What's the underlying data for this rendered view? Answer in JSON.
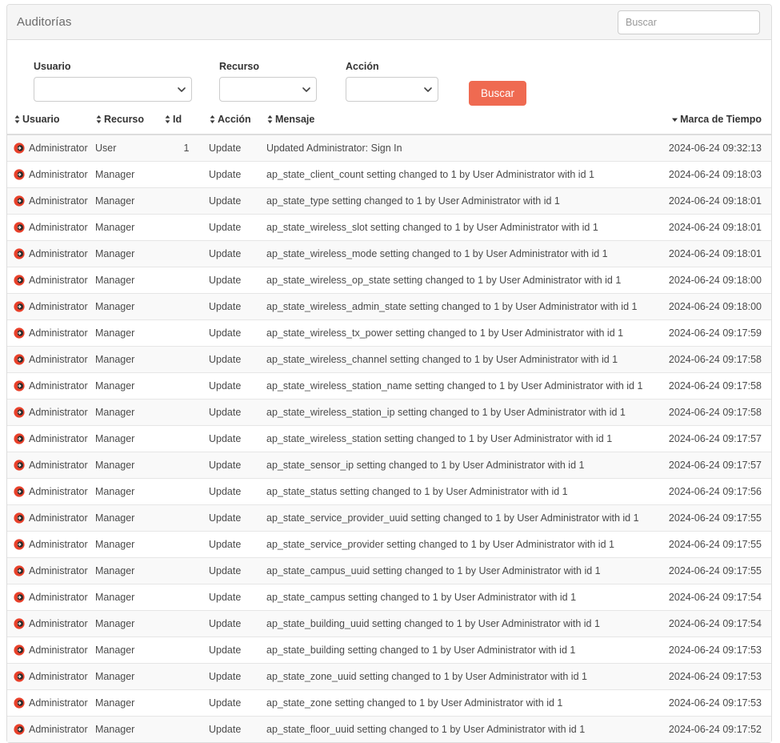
{
  "header": {
    "title": "Auditorías",
    "search_placeholder": "Buscar",
    "search_value": ""
  },
  "filters": {
    "groups": [
      {
        "label": "Usuario",
        "value": "",
        "options": [
          ""
        ]
      },
      {
        "label": "Recurso",
        "value": "",
        "options": [
          ""
        ]
      },
      {
        "label": "Acción",
        "value": "",
        "options": [
          ""
        ]
      }
    ],
    "submit_label": "Buscar"
  },
  "table": {
    "columns": [
      {
        "label": "Usuario",
        "sort": "both"
      },
      {
        "label": "Recurso",
        "sort": "both"
      },
      {
        "label": "Id",
        "sort": "both"
      },
      {
        "label": "Acción",
        "sort": "both"
      },
      {
        "label": "Mensaje",
        "sort": "both"
      },
      {
        "label": "Marca de Tiempo",
        "sort": "desc"
      }
    ],
    "row_icon": "user-circle-arrow-icon",
    "rows": [
      {
        "user": "Administrator",
        "resource": "User",
        "id": "1",
        "action": "Update",
        "message": "Updated Administrator: Sign In",
        "timestamp": "2024-06-24 09:32:13"
      },
      {
        "user": "Administrator",
        "resource": "Manager",
        "id": "",
        "action": "Update",
        "message": "ap_state_client_count setting changed to 1 by User Administrator with id 1",
        "timestamp": "2024-06-24 09:18:03"
      },
      {
        "user": "Administrator",
        "resource": "Manager",
        "id": "",
        "action": "Update",
        "message": "ap_state_type setting changed to 1 by User Administrator with id 1",
        "timestamp": "2024-06-24 09:18:01"
      },
      {
        "user": "Administrator",
        "resource": "Manager",
        "id": "",
        "action": "Update",
        "message": "ap_state_wireless_slot setting changed to 1 by User Administrator with id 1",
        "timestamp": "2024-06-24 09:18:01"
      },
      {
        "user": "Administrator",
        "resource": "Manager",
        "id": "",
        "action": "Update",
        "message": "ap_state_wireless_mode setting changed to 1 by User Administrator with id 1",
        "timestamp": "2024-06-24 09:18:01"
      },
      {
        "user": "Administrator",
        "resource": "Manager",
        "id": "",
        "action": "Update",
        "message": "ap_state_wireless_op_state setting changed to 1 by User Administrator with id 1",
        "timestamp": "2024-06-24 09:18:00"
      },
      {
        "user": "Administrator",
        "resource": "Manager",
        "id": "",
        "action": "Update",
        "message": "ap_state_wireless_admin_state setting changed to 1 by User Administrator with id 1",
        "timestamp": "2024-06-24 09:18:00"
      },
      {
        "user": "Administrator",
        "resource": "Manager",
        "id": "",
        "action": "Update",
        "message": "ap_state_wireless_tx_power setting changed to 1 by User Administrator with id 1",
        "timestamp": "2024-06-24 09:17:59"
      },
      {
        "user": "Administrator",
        "resource": "Manager",
        "id": "",
        "action": "Update",
        "message": "ap_state_wireless_channel setting changed to 1 by User Administrator with id 1",
        "timestamp": "2024-06-24 09:17:58"
      },
      {
        "user": "Administrator",
        "resource": "Manager",
        "id": "",
        "action": "Update",
        "message": "ap_state_wireless_station_name setting changed to 1 by User Administrator with id 1",
        "timestamp": "2024-06-24 09:17:58"
      },
      {
        "user": "Administrator",
        "resource": "Manager",
        "id": "",
        "action": "Update",
        "message": "ap_state_wireless_station_ip setting changed to 1 by User Administrator with id 1",
        "timestamp": "2024-06-24 09:17:58"
      },
      {
        "user": "Administrator",
        "resource": "Manager",
        "id": "",
        "action": "Update",
        "message": "ap_state_wireless_station setting changed to 1 by User Administrator with id 1",
        "timestamp": "2024-06-24 09:17:57"
      },
      {
        "user": "Administrator",
        "resource": "Manager",
        "id": "",
        "action": "Update",
        "message": "ap_state_sensor_ip setting changed to 1 by User Administrator with id 1",
        "timestamp": "2024-06-24 09:17:57"
      },
      {
        "user": "Administrator",
        "resource": "Manager",
        "id": "",
        "action": "Update",
        "message": "ap_state_status setting changed to 1 by User Administrator with id 1",
        "timestamp": "2024-06-24 09:17:56"
      },
      {
        "user": "Administrator",
        "resource": "Manager",
        "id": "",
        "action": "Update",
        "message": "ap_state_service_provider_uuid setting changed to 1 by User Administrator with id 1",
        "timestamp": "2024-06-24 09:17:55"
      },
      {
        "user": "Administrator",
        "resource": "Manager",
        "id": "",
        "action": "Update",
        "message": "ap_state_service_provider setting changed to 1 by User Administrator with id 1",
        "timestamp": "2024-06-24 09:17:55"
      },
      {
        "user": "Administrator",
        "resource": "Manager",
        "id": "",
        "action": "Update",
        "message": "ap_state_campus_uuid setting changed to 1 by User Administrator with id 1",
        "timestamp": "2024-06-24 09:17:55"
      },
      {
        "user": "Administrator",
        "resource": "Manager",
        "id": "",
        "action": "Update",
        "message": "ap_state_campus setting changed to 1 by User Administrator with id 1",
        "timestamp": "2024-06-24 09:17:54"
      },
      {
        "user": "Administrator",
        "resource": "Manager",
        "id": "",
        "action": "Update",
        "message": "ap_state_building_uuid setting changed to 1 by User Administrator with id 1",
        "timestamp": "2024-06-24 09:17:54"
      },
      {
        "user": "Administrator",
        "resource": "Manager",
        "id": "",
        "action": "Update",
        "message": "ap_state_building setting changed to 1 by User Administrator with id 1",
        "timestamp": "2024-06-24 09:17:53"
      },
      {
        "user": "Administrator",
        "resource": "Manager",
        "id": "",
        "action": "Update",
        "message": "ap_state_zone_uuid setting changed to 1 by User Administrator with id 1",
        "timestamp": "2024-06-24 09:17:53"
      },
      {
        "user": "Administrator",
        "resource": "Manager",
        "id": "",
        "action": "Update",
        "message": "ap_state_zone setting changed to 1 by User Administrator with id 1",
        "timestamp": "2024-06-24 09:17:53"
      },
      {
        "user": "Administrator",
        "resource": "Manager",
        "id": "",
        "action": "Update",
        "message": "ap_state_floor_uuid setting changed to 1 by User Administrator with id 1",
        "timestamp": "2024-06-24 09:17:52"
      }
    ]
  },
  "colors": {
    "accent": "#ef6a51",
    "row_icon": "#e8402a",
    "panel_border": "#dddddd",
    "heading_bg": "#f5f5f5",
    "stripe": "#f9f9f9"
  }
}
